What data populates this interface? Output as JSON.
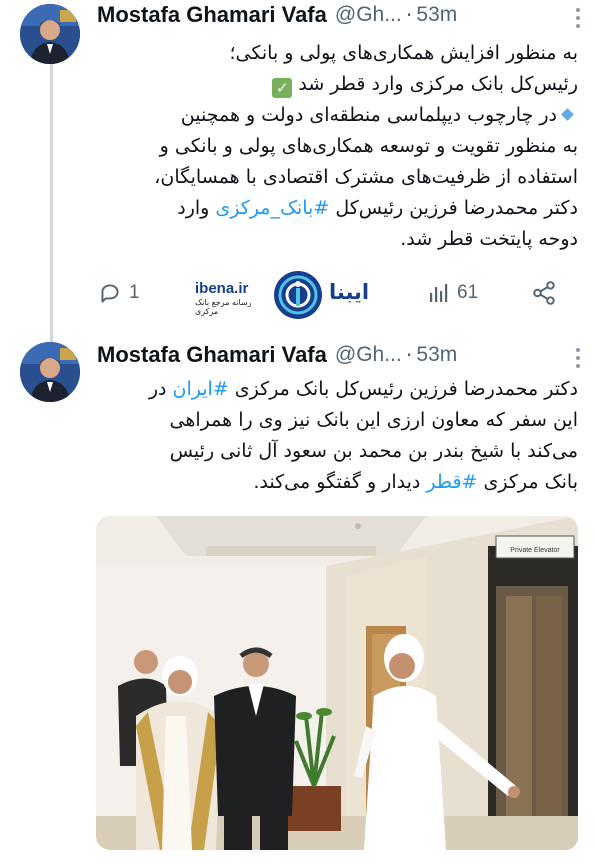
{
  "tweets": [
    {
      "author_name": "Mostafa Ghamari Vafa",
      "handle": "@Gh...",
      "separator": "·",
      "time": "53m",
      "lines": [
        "به منظور افزایش همکاری‌های پولی و بانکی؛",
        "رئیس‌کل بانک مرکزی وارد قطر شد",
        "در چارچوب دیپلماسی منطقه‌ای دولت و همچنین",
        "به منظور تقویت و توسعه همکاری‌های پولی و بانکی و",
        "استفاده از ظرفیت‌های مشترک اقتصادی با همسایگان،",
        "دکتر محمدرضا فرزین رئیس‌کل",
        "#بانک_مرکزی",
        "وارد",
        "دوحه پایتخت قطر شد."
      ],
      "reply_count": "1",
      "view_count": "61",
      "brand_logo_text": "ibena.ir",
      "brand_logo_subtext": "رسانه مرجع بانک مرکزی",
      "brand_logo_fa": "ایبنا"
    },
    {
      "author_name": "Mostafa Ghamari Vafa",
      "handle": "@Gh...",
      "separator": "·",
      "time": "53m",
      "lines": [
        "دکتر محمدرضا فرزین رئیس‌کل بانک مرکزی",
        "#ایران",
        "در",
        "این سفر که معاون ارزی این بانک نیز وی را همراهی",
        "می‌کند با شیخ بندر بن محمد بن سعود آل ثانی رئیس",
        "بانک مرکزی",
        "#قطر",
        "دیدار و گفتگو می‌کند."
      ],
      "photo_sign_text": "Private Elevator"
    }
  ],
  "colors": {
    "hashtag": "#1d9bf0",
    "secondary_text": "#536471",
    "thread_line": "#cfd9de",
    "check_emoji": "#78b159"
  },
  "icons": [
    "reply-icon",
    "views-icon",
    "share-icon",
    "more-icon",
    "check-mark-icon",
    "blue-diamond-icon"
  ]
}
